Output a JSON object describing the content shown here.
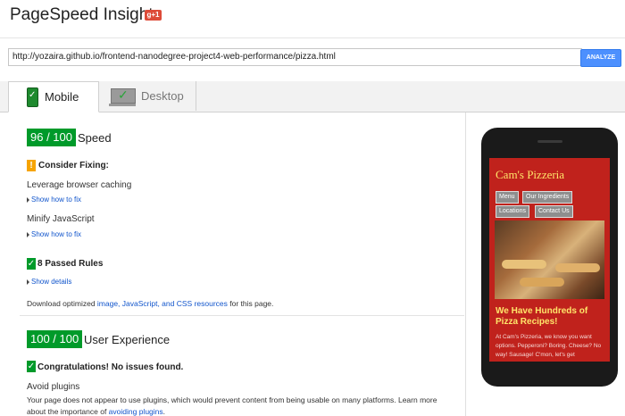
{
  "header": {
    "title": "PageSpeed Insights",
    "gplus": "g+1"
  },
  "urlbar": {
    "url": "http://yozaira.github.io/frontend-nanodegree-project4-web-performance/pizza.html",
    "analyze_label": "ANALYZE"
  },
  "tabs": [
    {
      "label": "Mobile",
      "active": true
    },
    {
      "label": "Desktop",
      "active": false
    }
  ],
  "speed": {
    "score": "96 / 100",
    "label": "Speed",
    "consider": {
      "icon": "!",
      "title": "Consider Fixing:",
      "items": [
        {
          "name": "Leverage browser caching",
          "link": "Show how to fix"
        },
        {
          "name": "Minify JavaScript",
          "link": "Show how to fix"
        }
      ]
    },
    "passed": {
      "icon": "✓",
      "title": "8 Passed Rules",
      "link": "Show details"
    },
    "download": {
      "prefix": "Download optimized ",
      "link": "image, JavaScript, and CSS resources",
      "suffix": " for this page."
    }
  },
  "ux": {
    "score": "100 / 100",
    "label": "User Experience",
    "congrats": {
      "icon": "✓",
      "title": "Congratulations! No issues found."
    },
    "avoid": {
      "title": "Avoid plugins",
      "text_1": "Your page does not appear to use plugins, which would prevent content from being usable on many platforms. Learn more",
      "text_2_prefix": "about the importance of ",
      "text_2_link": "avoiding plugins",
      "text_2_suffix": "."
    }
  },
  "preview": {
    "title": "Cam's Pizzeria",
    "nav": [
      "Menu",
      "Our Ingredients",
      "Locations",
      "Contact Us"
    ],
    "heading": "We Have Hundreds of Pizza Recipes!",
    "body": "At Cam's Pizzeria, we know you want options. Pepperoni? Boring. Cheese? No way! Sausage! C'mon, let's get"
  },
  "colors": {
    "score_green": "#009a2a",
    "warning_orange": "#f6a400",
    "link_blue": "#1155cc",
    "screen_red": "#c0221c",
    "analyze_blue": "#4d90fe"
  }
}
